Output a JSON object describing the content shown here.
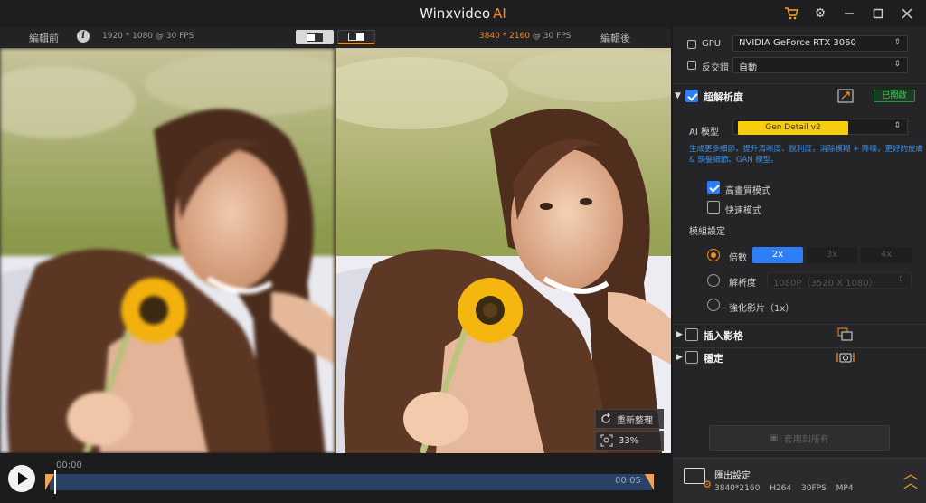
{
  "app": {
    "title": "Winxvideo",
    "title_accent": "AI"
  },
  "window_controls": [
    "cart-icon",
    "gear-icon",
    "minimize-icon",
    "maximize-icon",
    "close-icon"
  ],
  "compare": {
    "left_label": "編輯前",
    "left_resolution": "1920 * 1080 @ 30 FPS",
    "right_resolution_hl": "3840 * 2160",
    "right_resolution_rest": "@ 30 FPS",
    "right_label": "編輯後"
  },
  "overlay": {
    "reset_label": "重新整理",
    "zoom_label": "33%"
  },
  "timeline": {
    "current": "00:00",
    "end": "00:05"
  },
  "panel": {
    "gpu_label": "GPU",
    "gpu_value": "NVIDIA GeForce RTX 3060",
    "aa_label": "反交錯",
    "aa_value": "自動",
    "super_res": {
      "title": "超解析度",
      "enabled": true,
      "status": "已開啟",
      "model_label": "AI 模型",
      "model_value": "Gen Detail v2",
      "description": "生成更多細節，提升清晰度、銳利度，消除模糊 + 降噪，更好的皮膚 & 頭髮細節。GAN 模型。",
      "hq_label": "高畫質模式",
      "hq_checked": true,
      "fast_label": "快速模式",
      "fast_checked": false,
      "module_label": "模組設定",
      "scale_label": "倍數",
      "scale_options": [
        "2x",
        "3x",
        "4x"
      ],
      "scale_selected": "2x",
      "resolution_label": "解析度",
      "resolution_value": "1080P（3520 X 1080）",
      "enhance_label": "強化影片（1x）"
    },
    "frame_interp": {
      "title": "插入影格",
      "enabled": false
    },
    "stabilize": {
      "title": "穩定",
      "enabled": false
    },
    "apply_label": "套用到所有",
    "export": {
      "title": "匯出設定",
      "spec": [
        "3840*2160",
        "H264",
        "30FPS",
        "MP4"
      ]
    }
  },
  "colors": {
    "accent": "#f58a1f",
    "blue": "#2d7ff9",
    "model_yellow": "#f7cd0e",
    "ok_green": "#3fd05a"
  }
}
